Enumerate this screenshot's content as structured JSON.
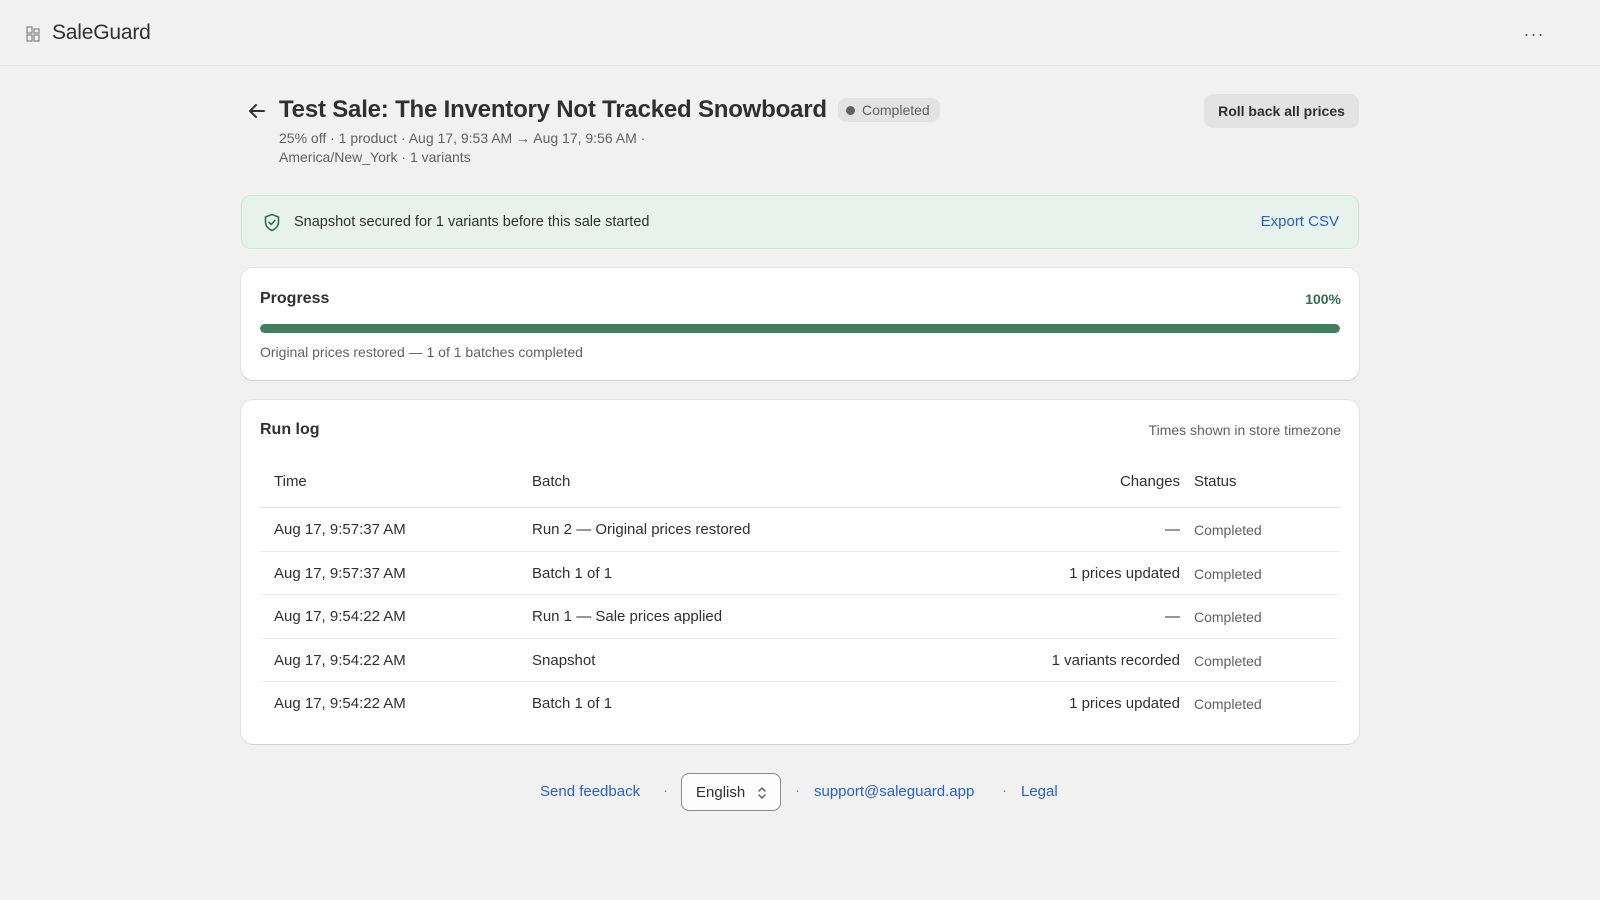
{
  "app": {
    "name": "SaleGuard",
    "more_label": "···"
  },
  "header": {
    "title": "Test Sale: The Inventory Not Tracked Snowboard",
    "status": "Completed",
    "meta_line_1": "25% off · 1 product · Aug 17, 9:53 AM → Aug 17, 9:56 AM ·",
    "meta_line_2": "America/New_York · 1 variants",
    "rollback_label": "Roll back all prices"
  },
  "snapshot_banner": {
    "text": "Snapshot secured for 1 variants before this sale started",
    "export_label": "Export CSV"
  },
  "progress": {
    "title": "Progress",
    "percent_label": "100%",
    "percent_value": 1.0,
    "note": "Original prices restored — 1 of 1 batches completed",
    "accent_color": "#3f7f5c"
  },
  "run_log": {
    "title": "Run log",
    "timezone_note": "Times shown in store timezone",
    "columns": {
      "time": "Time",
      "batch": "Batch",
      "changes": "Changes",
      "status": "Status"
    },
    "rows": [
      {
        "time": "Aug 17, 9:57:37 AM",
        "batch": "Run 2 — Original prices restored",
        "changes": "—",
        "status": "Completed"
      },
      {
        "time": "Aug 17, 9:57:37 AM",
        "batch": "Batch 1 of 1",
        "changes": "1 prices updated",
        "status": "Completed"
      },
      {
        "time": "Aug 17, 9:54:22 AM",
        "batch": "Run 1 — Sale prices applied",
        "changes": "—",
        "status": "Completed"
      },
      {
        "time": "Aug 17, 9:54:22 AM",
        "batch": "Snapshot",
        "changes": "1 variants recorded",
        "status": "Completed"
      },
      {
        "time": "Aug 17, 9:54:22 AM",
        "batch": "Batch 1 of 1",
        "changes": "1 prices updated",
        "status": "Completed"
      }
    ]
  },
  "footer": {
    "feedback_label": "Send feedback",
    "language": "English",
    "support_email": "support@saleguard.app",
    "legal_label": "Legal",
    "separator": "·"
  }
}
